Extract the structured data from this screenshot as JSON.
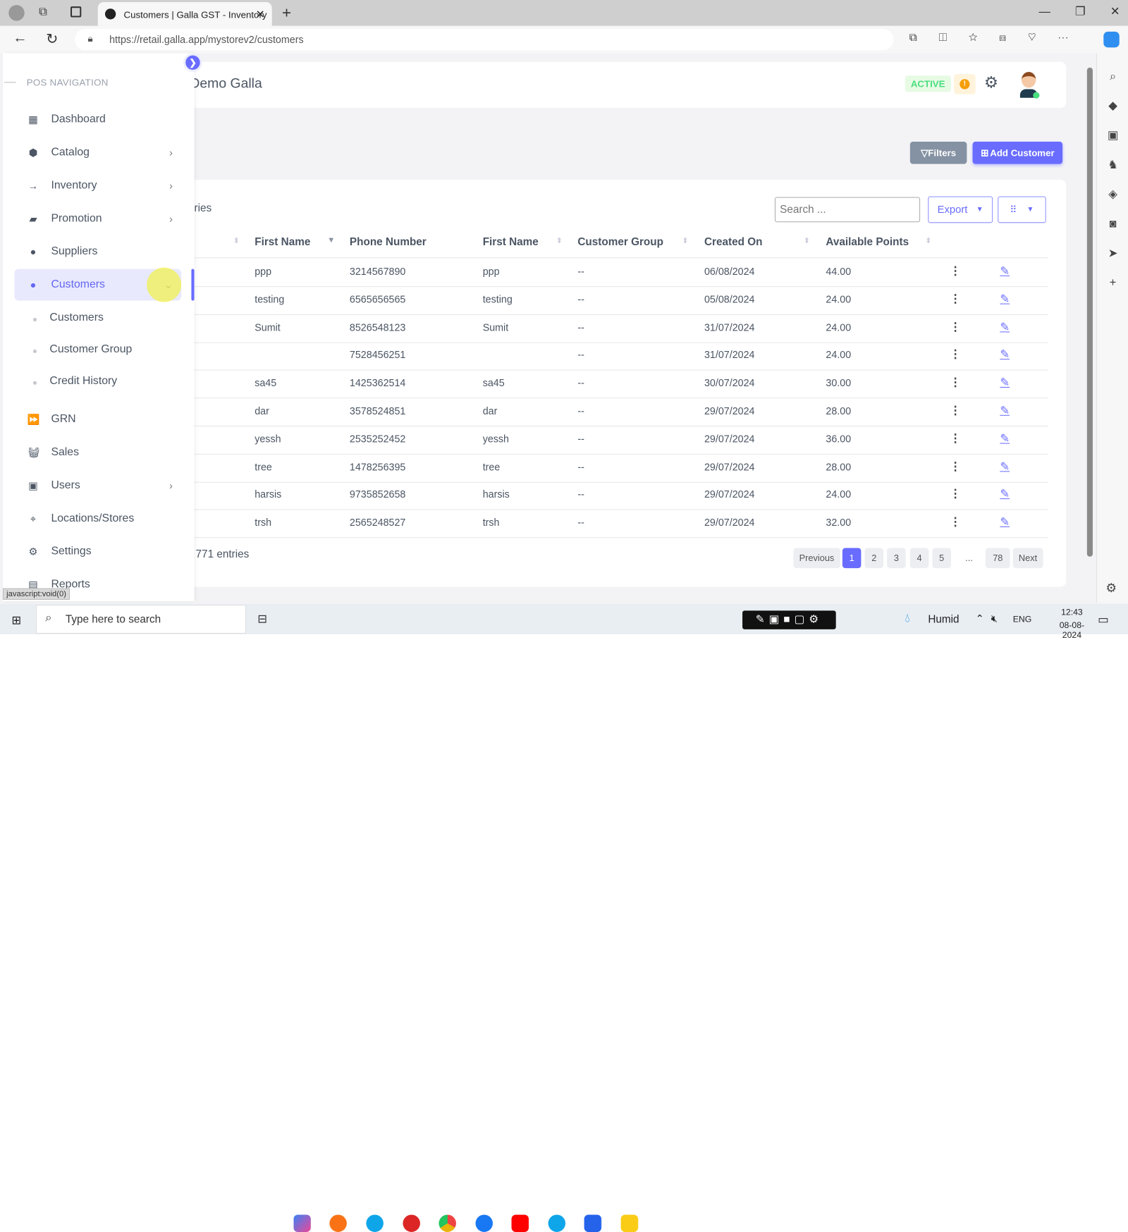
{
  "browser": {
    "tab_title": "Customers | Galla GST - Inventory",
    "url": "https://retail.galla.app/mystorev2/customers",
    "status_text": "javascript:void(0)"
  },
  "header": {
    "store": "Demo Galla",
    "status": "ACTIVE"
  },
  "sidebar": {
    "title": "POS NAVIGATION",
    "items": [
      {
        "label": "Dashboard",
        "icon": "dashboard-icon",
        "chevron": false
      },
      {
        "label": "Catalog",
        "icon": "box-icon",
        "chevron": true
      },
      {
        "label": "Inventory",
        "icon": "arrow-right-icon",
        "chevron": true
      },
      {
        "label": "Promotion",
        "icon": "ticket-icon",
        "chevron": true
      },
      {
        "label": "Suppliers",
        "icon": "user-circle-icon",
        "chevron": false
      },
      {
        "label": "Customers",
        "icon": "user-circle-icon",
        "chevron": true,
        "active": true
      },
      {
        "label": "GRN",
        "icon": "forward-icon",
        "chevron": false
      },
      {
        "label": "Sales",
        "icon": "basket-icon",
        "chevron": false
      },
      {
        "label": "Users",
        "icon": "users-icon",
        "chevron": true
      },
      {
        "label": "Locations/Stores",
        "icon": "location-icon",
        "chevron": false
      },
      {
        "label": "Settings",
        "icon": "gear-icon",
        "chevron": false
      },
      {
        "label": "Reports",
        "icon": "report-icon",
        "chevron": false
      }
    ],
    "sub_items": [
      "Customers",
      "Customer Group",
      "Credit History"
    ]
  },
  "toolbar": {
    "filters": "Filters",
    "add_customer": "Add Customer",
    "entries_label": "ries",
    "search_placeholder": "Search ...",
    "export": "Export"
  },
  "table": {
    "headers": [
      "First Name",
      "Phone Number",
      "First Name",
      "Customer Group",
      "Created On",
      "Available Points"
    ],
    "rows": [
      [
        "ppp",
        "3214567890",
        "ppp",
        "--",
        "06/08/2024",
        "44.00"
      ],
      [
        "testing",
        "6565656565",
        "testing",
        "--",
        "05/08/2024",
        "24.00"
      ],
      [
        "Sumit",
        "8526548123",
        "Sumit",
        "--",
        "31/07/2024",
        "24.00"
      ],
      [
        "",
        "7528456251",
        "",
        "--",
        "31/07/2024",
        "24.00"
      ],
      [
        "sa45",
        "1425362514",
        "sa45",
        "--",
        "30/07/2024",
        "30.00"
      ],
      [
        "dar",
        "3578524851",
        "dar",
        "--",
        "29/07/2024",
        "28.00"
      ],
      [
        "yessh",
        "2535252452",
        "yessh",
        "--",
        "29/07/2024",
        "36.00"
      ],
      [
        "tree",
        "1478256395",
        "tree",
        "--",
        "29/07/2024",
        "28.00"
      ],
      [
        "harsis",
        "9735852658",
        "harsis",
        "--",
        "29/07/2024",
        "24.00"
      ],
      [
        "trsh",
        "2565248527",
        "trsh",
        "--",
        "29/07/2024",
        "32.00"
      ]
    ]
  },
  "footer": {
    "entries": "771 entries",
    "pages": [
      "Previous",
      "1",
      "2",
      "3",
      "4",
      "5",
      "...",
      "78",
      "Next"
    ],
    "current_page": "1"
  },
  "taskbar": {
    "search": "Type here to search",
    "weather": "Humid",
    "lang": "ENG",
    "time": "12:43",
    "date": "08-08-2024"
  },
  "colors": {
    "accent": "#6366f1",
    "active_green": "#4ade80"
  }
}
